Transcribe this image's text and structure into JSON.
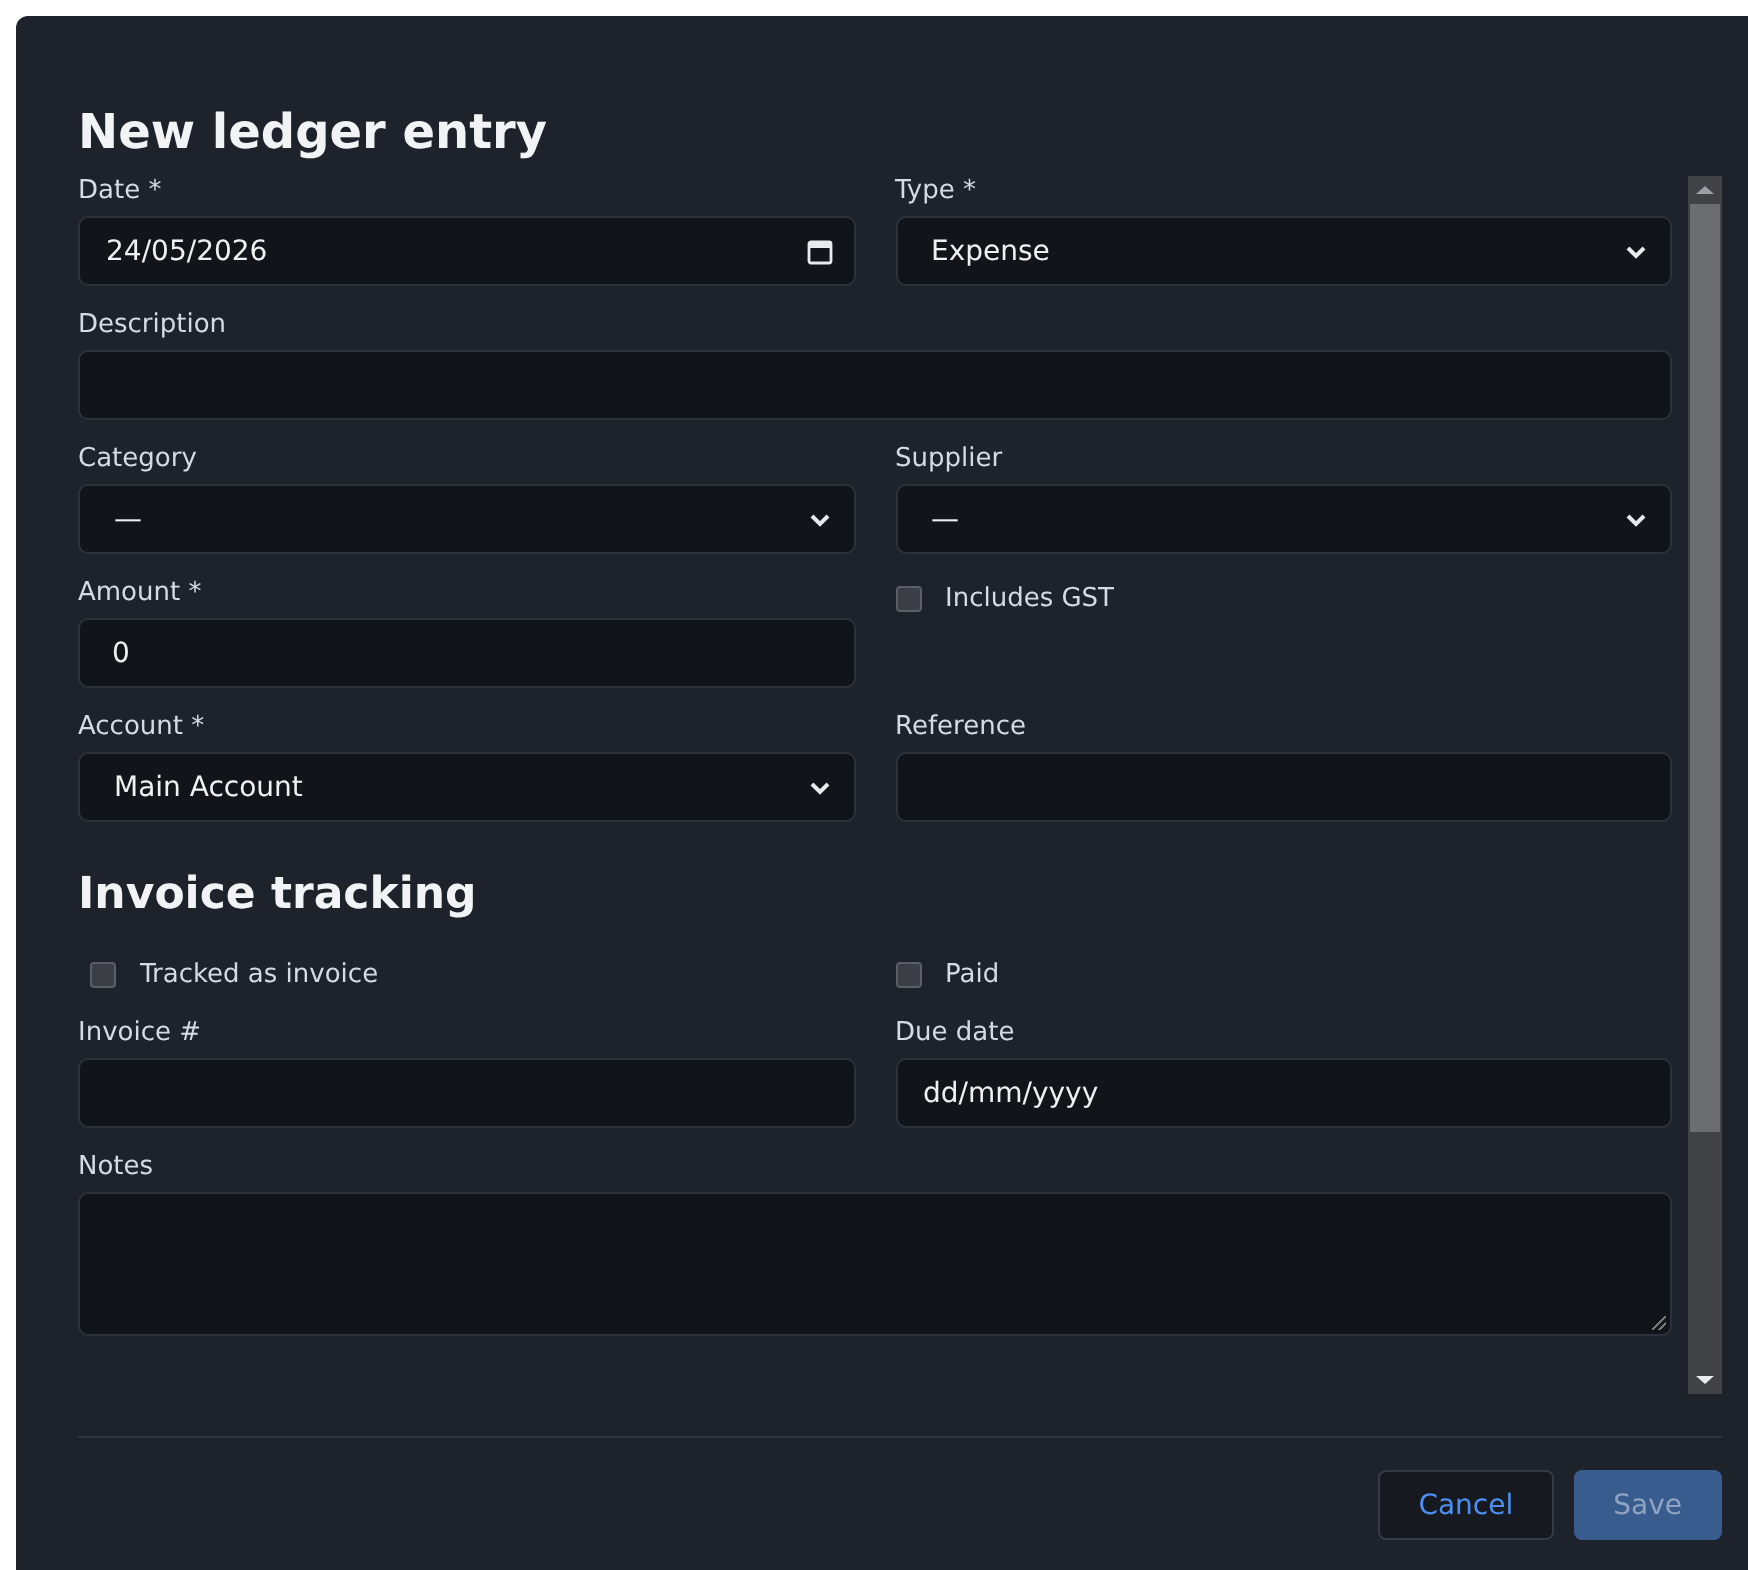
{
  "dialog": {
    "title": "New ledger entry",
    "sections": [
      {
        "rows": [
          [
            {
              "kind": "date",
              "label": "Date *",
              "value": "24/05/2026"
            },
            {
              "kind": "select",
              "label": "Type *",
              "value": "Expense"
            }
          ],
          [
            {
              "kind": "text",
              "label": "Description"
            }
          ],
          [
            {
              "kind": "select",
              "label": "Category",
              "value": "—"
            },
            {
              "kind": "select",
              "label": "Supplier",
              "value": "—"
            }
          ],
          [
            {
              "kind": "text",
              "label": "Amount *",
              "value": "0"
            },
            {
              "kind": "checkbox",
              "label": "Includes GST",
              "checked": false
            }
          ],
          [
            {
              "kind": "select",
              "label": "Account *",
              "value": "Main Account"
            },
            {
              "kind": "text",
              "label": "Reference"
            }
          ]
        ]
      },
      {
        "heading": "Invoice tracking",
        "rows": [
          [
            {
              "kind": "checkbox",
              "label": "Tracked as invoice",
              "checked": false
            },
            {
              "kind": "checkbox",
              "label": "Paid",
              "checked": false
            }
          ],
          [
            {
              "kind": "text",
              "label": "Invoice #"
            },
            {
              "kind": "date",
              "label": "Due date",
              "placeholder": "dd/mm/yyyy"
            }
          ],
          [
            {
              "kind": "textarea",
              "label": "Notes"
            }
          ]
        ]
      }
    ],
    "buttons": [
      {
        "label": "Cancel",
        "kind": "secondary",
        "disabled": false
      },
      {
        "label": "Save",
        "kind": "primary",
        "disabled": true
      }
    ]
  }
}
